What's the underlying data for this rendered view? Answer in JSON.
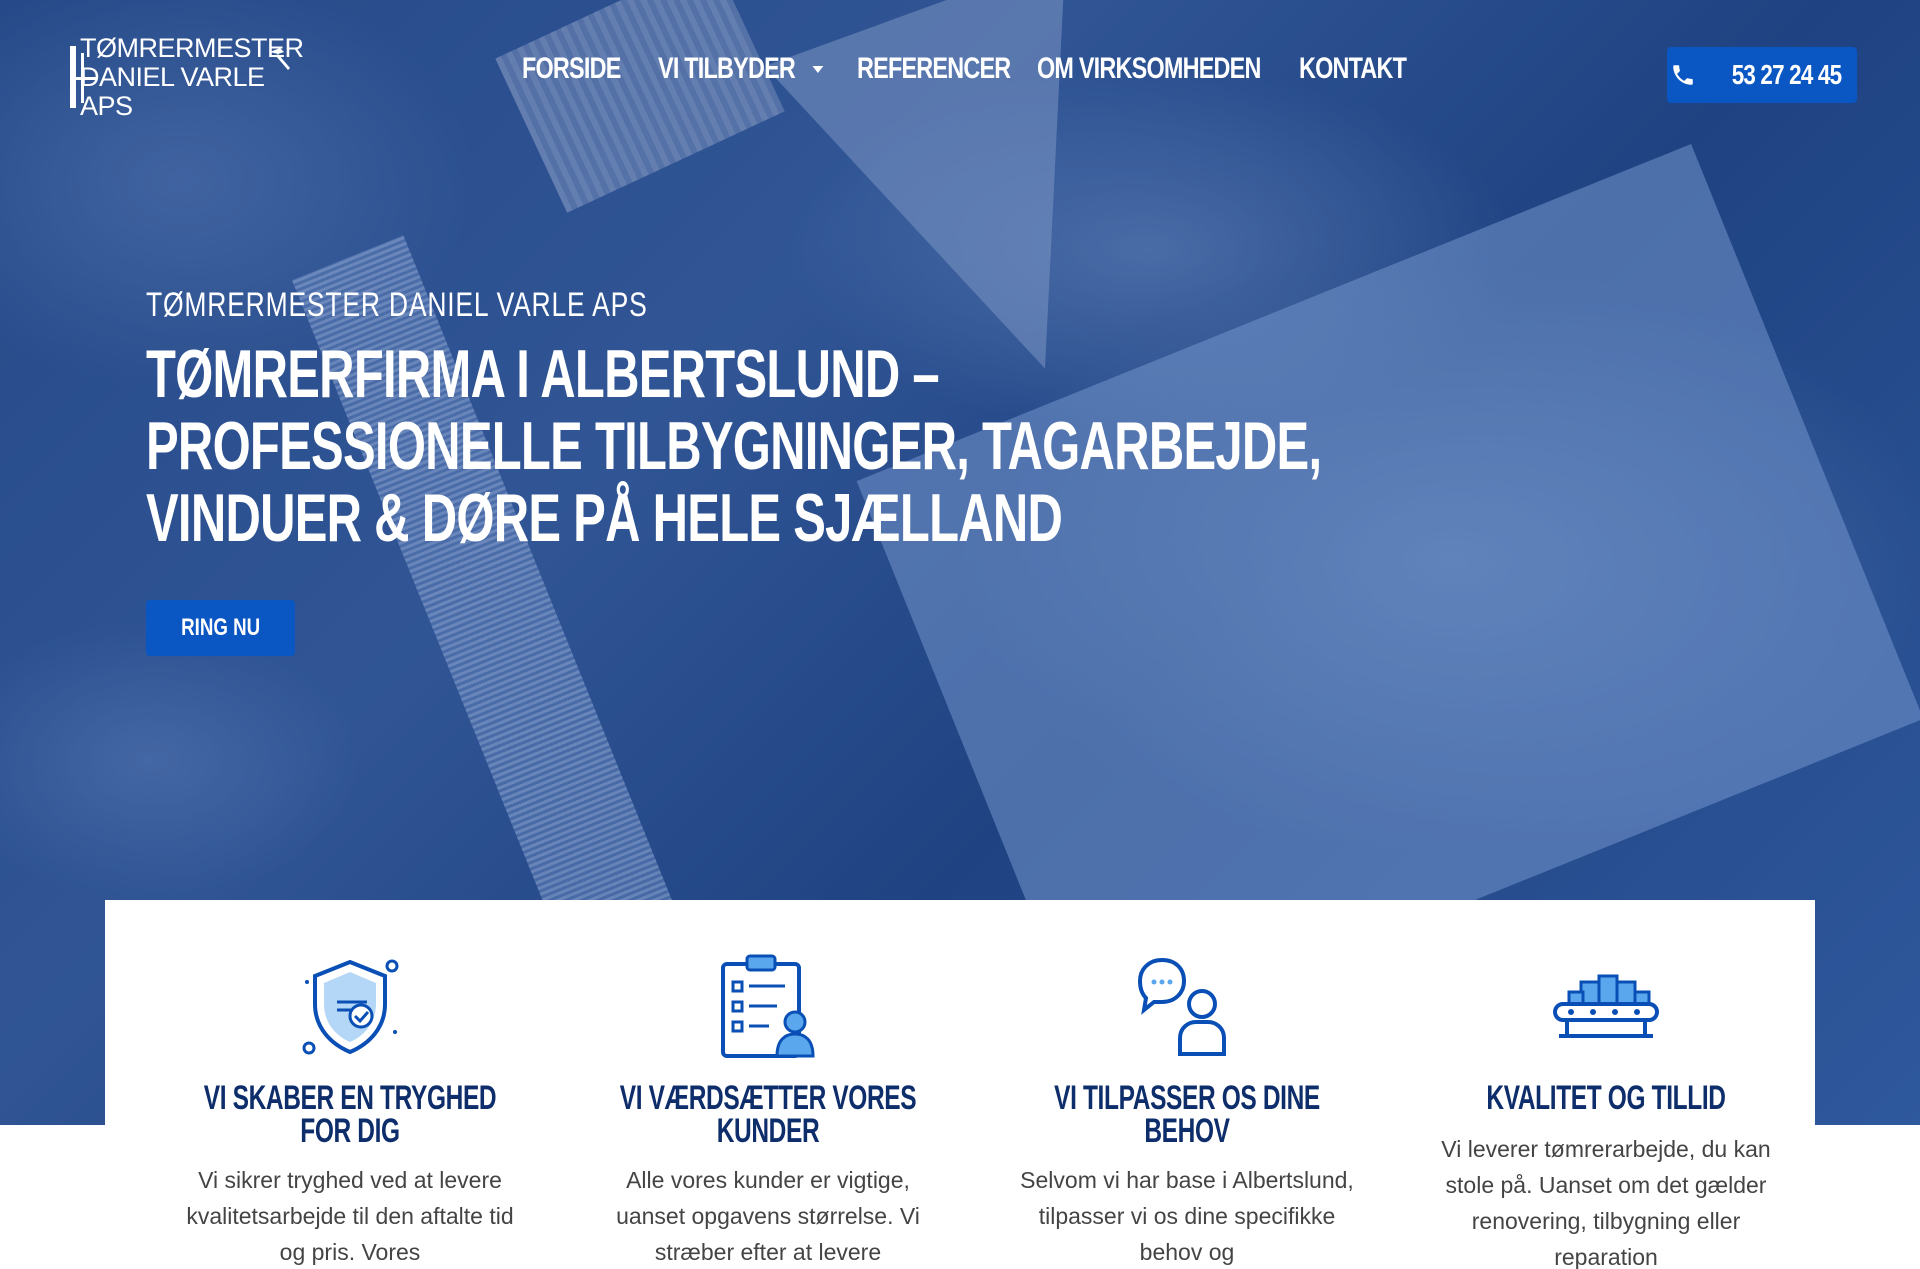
{
  "header": {
    "logo_line1": "TØMRERMESTER",
    "logo_line2": "DANIEL VARLE APS",
    "nav": [
      {
        "label": "FORSIDE"
      },
      {
        "label": "VI TILBYDER"
      },
      {
        "label": "REFERENCER"
      },
      {
        "label": "OM VIRKSOMHEDEN"
      },
      {
        "label": "KONTAKT"
      }
    ],
    "phone": "53 27 24 45"
  },
  "hero": {
    "eyebrow": "TØMRERMESTER DANIEL VARLE APS",
    "headline_lines": [
      "TØMRERFIRMA I ALBERTSLUND –",
      "PROFESSIONELLE TILBYGNINGER, TAGARBEJDE,",
      "VINDUER & DØRE PÅ HELE SJÆLLAND"
    ],
    "cta": "RING NU"
  },
  "features": [
    {
      "icon": "shield-check-icon",
      "title": "VI SKABER EN TRYGHED FOR DIG",
      "text": "Vi sikrer tryghed ved at levere kvalitetsarbejde til den aftalte tid og pris. Vores"
    },
    {
      "icon": "clipboard-checklist-icon",
      "title": "VI VÆRDSÆTTER VORES KUNDER",
      "text": "Alle vores kunder er vigtige, uanset opgavens størrelse. Vi stræber efter at levere"
    },
    {
      "icon": "chat-person-icon",
      "title": "VI TILPASSER OS DINE BEHOV",
      "text": "Selvom vi har base i Albertslund, tilpasser vi os dine specifikke behov og"
    },
    {
      "icon": "conveyor-boxes-icon",
      "title": "KVALITET OG TILLID",
      "text": "Vi leverer tømrerarbejde, du kan stole på. Uanset om det gælder renovering, tilbygning eller reparation"
    }
  ],
  "colors": {
    "primary_button": "#0a56c2",
    "feature_title": "#0e2d6b",
    "icon_dark": "#0a4fb5",
    "icon_light": "#5aa7ee"
  }
}
